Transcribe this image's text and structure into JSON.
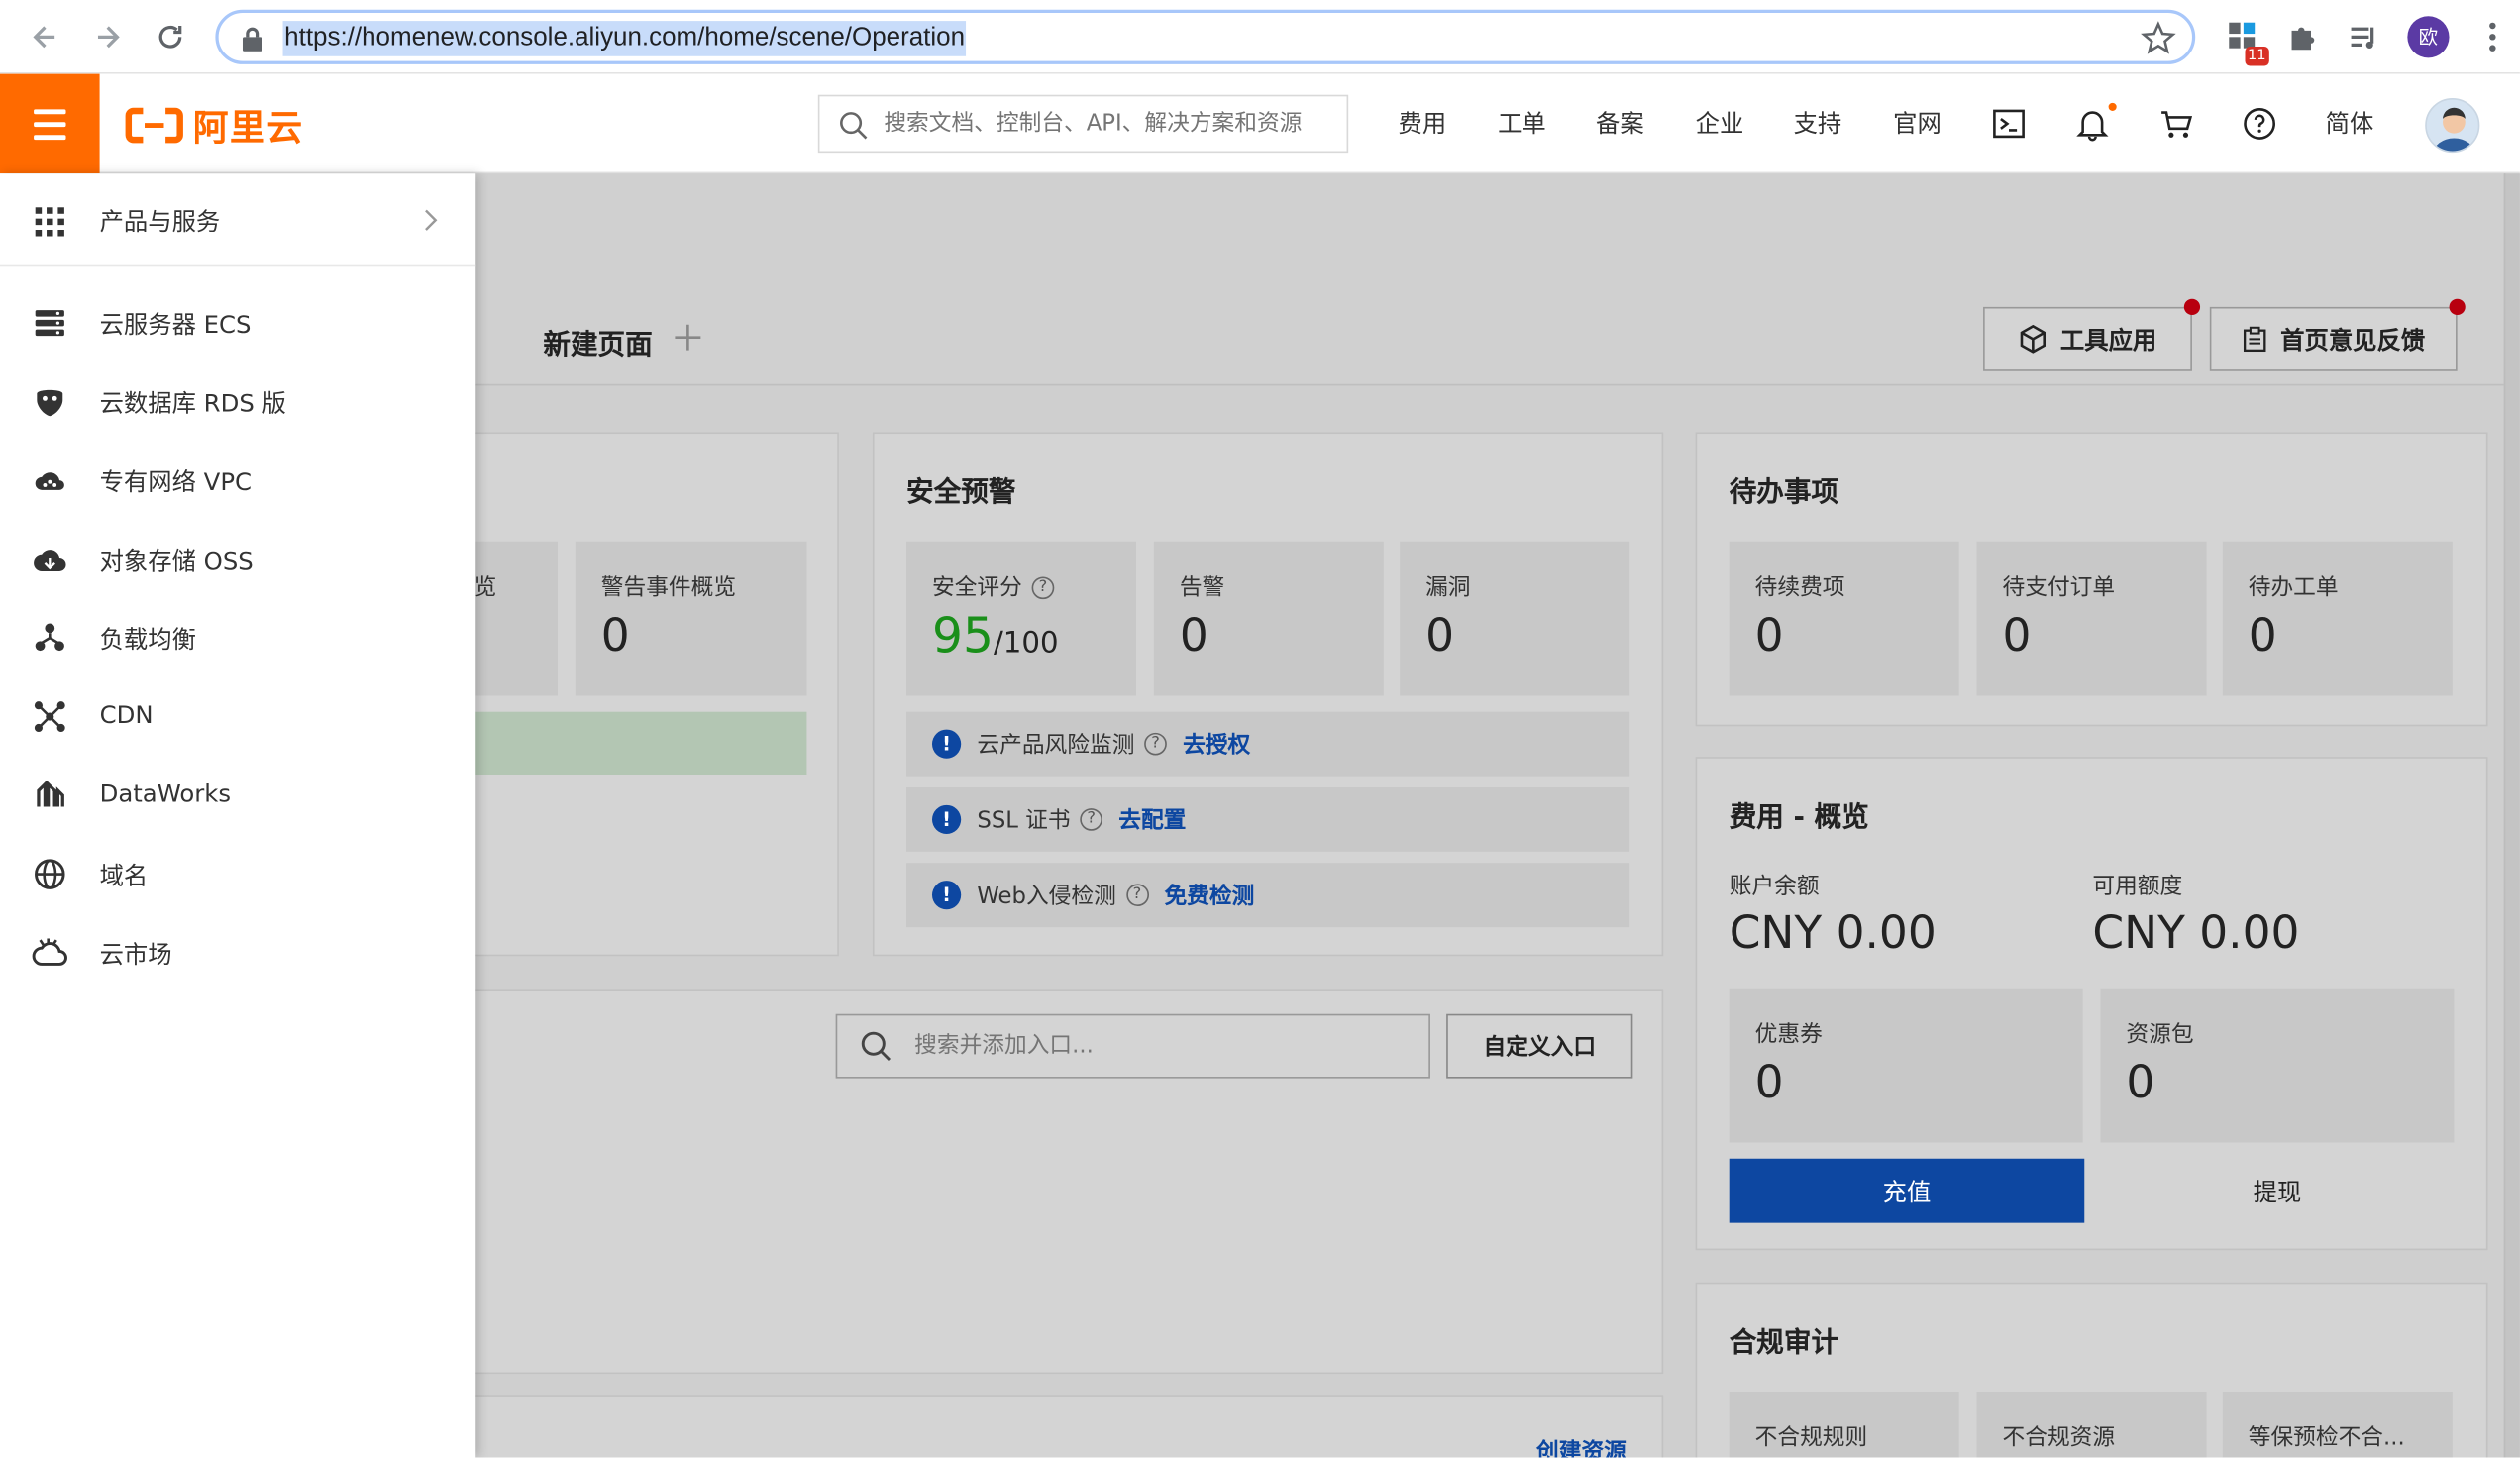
{
  "browser": {
    "url": "https://homenew.console.aliyun.com/home/scene/Operation",
    "extension_badge": "11",
    "profile_initial": "欧"
  },
  "header": {
    "logo_text": "阿里云",
    "search_placeholder": "搜索文档、控制台、API、解决方案和资源",
    "nav": [
      "费用",
      "工单",
      "备案",
      "企业",
      "支持",
      "官网"
    ],
    "language": "简体"
  },
  "sidebar": {
    "products_label": "产品与服务",
    "items": [
      {
        "label": "云服务器 ECS",
        "icon": "server-icon"
      },
      {
        "label": "云数据库 RDS 版",
        "icon": "database-icon"
      },
      {
        "label": "专有网络 VPC",
        "icon": "cloud-network-icon"
      },
      {
        "label": "对象存储 OSS",
        "icon": "cloud-storage-icon"
      },
      {
        "label": "负载均衡",
        "icon": "load-balancer-icon"
      },
      {
        "label": "CDN",
        "icon": "cdn-icon"
      },
      {
        "label": "DataWorks",
        "icon": "dataworks-icon"
      },
      {
        "label": "域名",
        "icon": "globe-icon"
      },
      {
        "label": "云市场",
        "icon": "marketplace-icon"
      }
    ]
  },
  "pagehead": {
    "new_page": "新建页面",
    "tools_button": "工具应用",
    "feedback_button": "首页意见反馈"
  },
  "left_card": {
    "partial_label": "览",
    "alarm_overview_label": "警告事件概览",
    "alarm_overview_value": "0"
  },
  "security": {
    "title": "安全预警",
    "score_label": "安全评分",
    "score": "95",
    "score_max": "/100",
    "alarms_label": "告警",
    "alarms_value": "0",
    "vuln_label": "漏洞",
    "vuln_value": "0",
    "rows": [
      {
        "text": "云产品风险监测",
        "link": "去授权"
      },
      {
        "text": "SSL 证书",
        "link": "去配置"
      },
      {
        "text": "Web入侵检测",
        "link": "免费检测"
      }
    ]
  },
  "entry": {
    "search_placeholder": "搜索并添加入口...",
    "custom_button": "自定义入口",
    "create_link": "创建资源"
  },
  "todo": {
    "title": "待办事项",
    "items": [
      {
        "label": "待续费项",
        "value": "0"
      },
      {
        "label": "待支付订单",
        "value": "0"
      },
      {
        "label": "待办工单",
        "value": "0"
      }
    ]
  },
  "fees": {
    "title": "费用 - 概览",
    "balance_label": "账户余额",
    "balance_value": "CNY 0.00",
    "credit_label": "可用额度",
    "credit_value": "CNY 0.00",
    "coupon_label": "优惠券",
    "coupon_value": "0",
    "package_label": "资源包",
    "package_value": "0",
    "recharge_button": "充值",
    "withdraw_button": "提现"
  },
  "compliance": {
    "title": "合规审计",
    "items": [
      "不合规规则",
      "不合规资源",
      "等保预检不合..."
    ]
  },
  "colors": {
    "brand": "#ff6a00",
    "link": "#0d47a1",
    "score": "#1a8f1a"
  }
}
